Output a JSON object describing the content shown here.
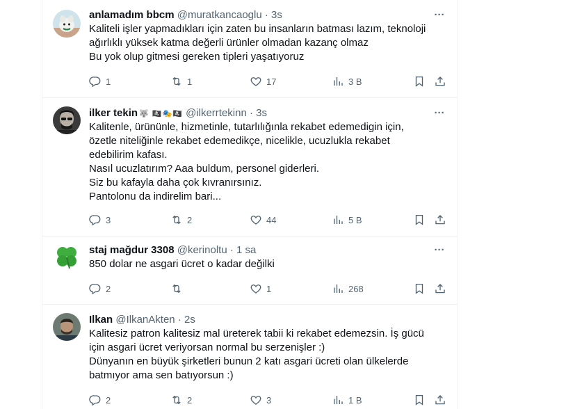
{
  "tweets": [
    {
      "name": "anlamadım bbcm",
      "handle": "@muratkancaoglu",
      "time": "3s",
      "lines": [
        "Kaliteli işler yapmadıkları için zaten bu insanların batması lazım, teknoloji",
        "ağırlıklı yüksek katma değerli ürünler olmadan kazanç olmaz",
        "Bu yok olup gitmesi gereken tipleri yaşatıyoruz"
      ],
      "replies": "1",
      "reposts": "1",
      "likes": "17",
      "views": "3 B"
    },
    {
      "name": "ilker tekin",
      "emoji": "🐺 🏴‍☠️🎭🏴‍☠️",
      "handle": "@ilkerrtekinn",
      "time": "3s",
      "lines": [
        "Kalitenle, ürününle, hizmetinle, tutarlılığınla rekabet edemedigin için,",
        "özetle niteliğinle rekabet edemedikçe, nicelikle, ucuzlukla rekabet",
        "edebilirim kafası.",
        "Nasıl ucuzlatırım? Aaa buldum, personel giderleri.",
        "Siz bu kafayla daha çok kıvranırsınız.",
        "Pantolonu da indirelim bari..."
      ],
      "replies": "3",
      "reposts": "2",
      "likes": "44",
      "views": "5 B"
    },
    {
      "name": "staj mağdur 3308",
      "handle": "@kerinoltu",
      "time": "1 sa",
      "lines": [
        "850 dolar ne asgari ücret o kadar değilki"
      ],
      "replies": "2",
      "reposts": "",
      "likes": "1",
      "views": "268"
    },
    {
      "name": "Ilkan",
      "handle": "@IlkanAkten",
      "time": "2s",
      "lines": [
        "Kalitesiz patron kalitesiz mal üreterek tabii ki rekabet edemezsin. İş gücü",
        "için asgari ücret veriyorsan normal bu serzenişler :)",
        "Dünyanın en büyük şirketleri bunun 2 katı asgari ücreti olan ülkelerde",
        "batmıyor ama sen batıyorsun :)"
      ],
      "replies": "2",
      "reposts": "2",
      "likes": "3",
      "views": "1 B"
    }
  ],
  "icons": {
    "reply": "reply-icon",
    "repost": "repost-icon",
    "like": "like-icon",
    "views": "views-icon",
    "bookmark": "bookmark-icon",
    "share": "share-icon",
    "more": "more-icon"
  },
  "colors": {
    "text": "#0f1419",
    "secondary": "#536471",
    "border": "#eff3f4"
  },
  "more_label": "···"
}
